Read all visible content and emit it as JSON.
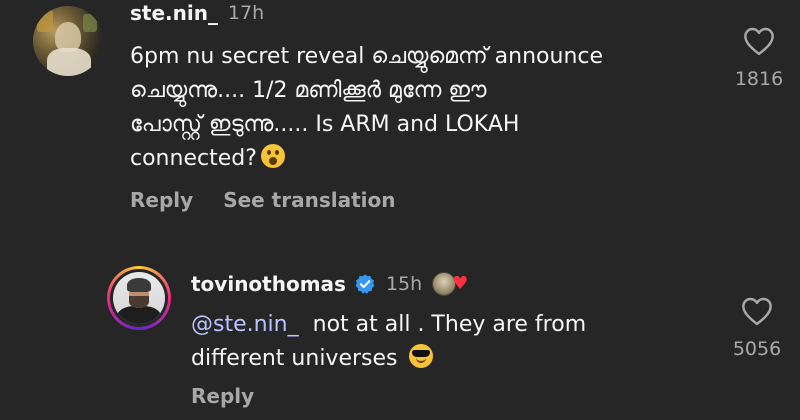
{
  "comments": [
    {
      "username": "ste.nin_",
      "time": "17h",
      "text_lines": [
        "6pm nu secret reveal ചെയ്യുമെന്ന് announce",
        "ചെയ്യുന്നു.... 1/2 മണിക്കൂർ മുന്നേ ഈ",
        "പോസ്റ്റ് ഇടുന്നു..... Is ARM and LOKAH",
        "connected?"
      ],
      "reply_label": "Reply",
      "translate_label": "See translation",
      "likes": "1816"
    },
    {
      "username": "tovinothomas",
      "time": "15h",
      "mention": "@ste.nin_",
      "text_part1": "not at all . They are from",
      "text_part2": "different universes",
      "reply_label": "Reply",
      "likes": "5056"
    }
  ],
  "colors": {
    "background": "#262626",
    "text": "#f5f5f5",
    "muted": "#a8a8a8",
    "mention": "#b9c3ff",
    "verified": "#3797f0",
    "heart": "#ff3040"
  },
  "icons": {
    "like": "heart-outline-icon",
    "verified": "verified-badge-icon"
  }
}
